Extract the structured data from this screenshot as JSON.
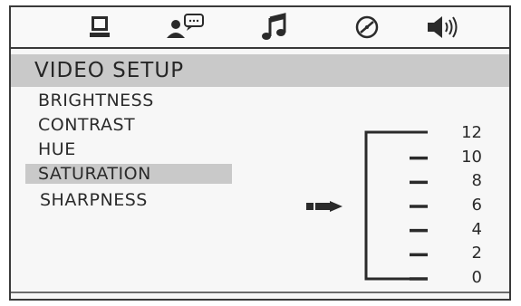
{
  "tabs": [
    {
      "icon": "monitor-icon"
    },
    {
      "icon": "user-chat-icon"
    },
    {
      "icon": "music-note-icon"
    },
    {
      "icon": "disc-icon"
    },
    {
      "icon": "speaker-icon"
    }
  ],
  "header": {
    "title": "VIDEO SETUP"
  },
  "menu": {
    "items": [
      {
        "label": "BRIGHTNESS"
      },
      {
        "label": "CONTRAST"
      },
      {
        "label": "HUE"
      },
      {
        "label": "SATURATION"
      },
      {
        "label": "SHARPNESS"
      }
    ],
    "selected_index": 3
  },
  "scale": {
    "ticks": [
      "12",
      "10",
      "8",
      "6",
      "4",
      "2",
      "0"
    ],
    "current_value": 6
  },
  "colors": {
    "background": "#f7f7f7",
    "highlight": "#c9c9c9",
    "ink": "#2b2b2b"
  }
}
